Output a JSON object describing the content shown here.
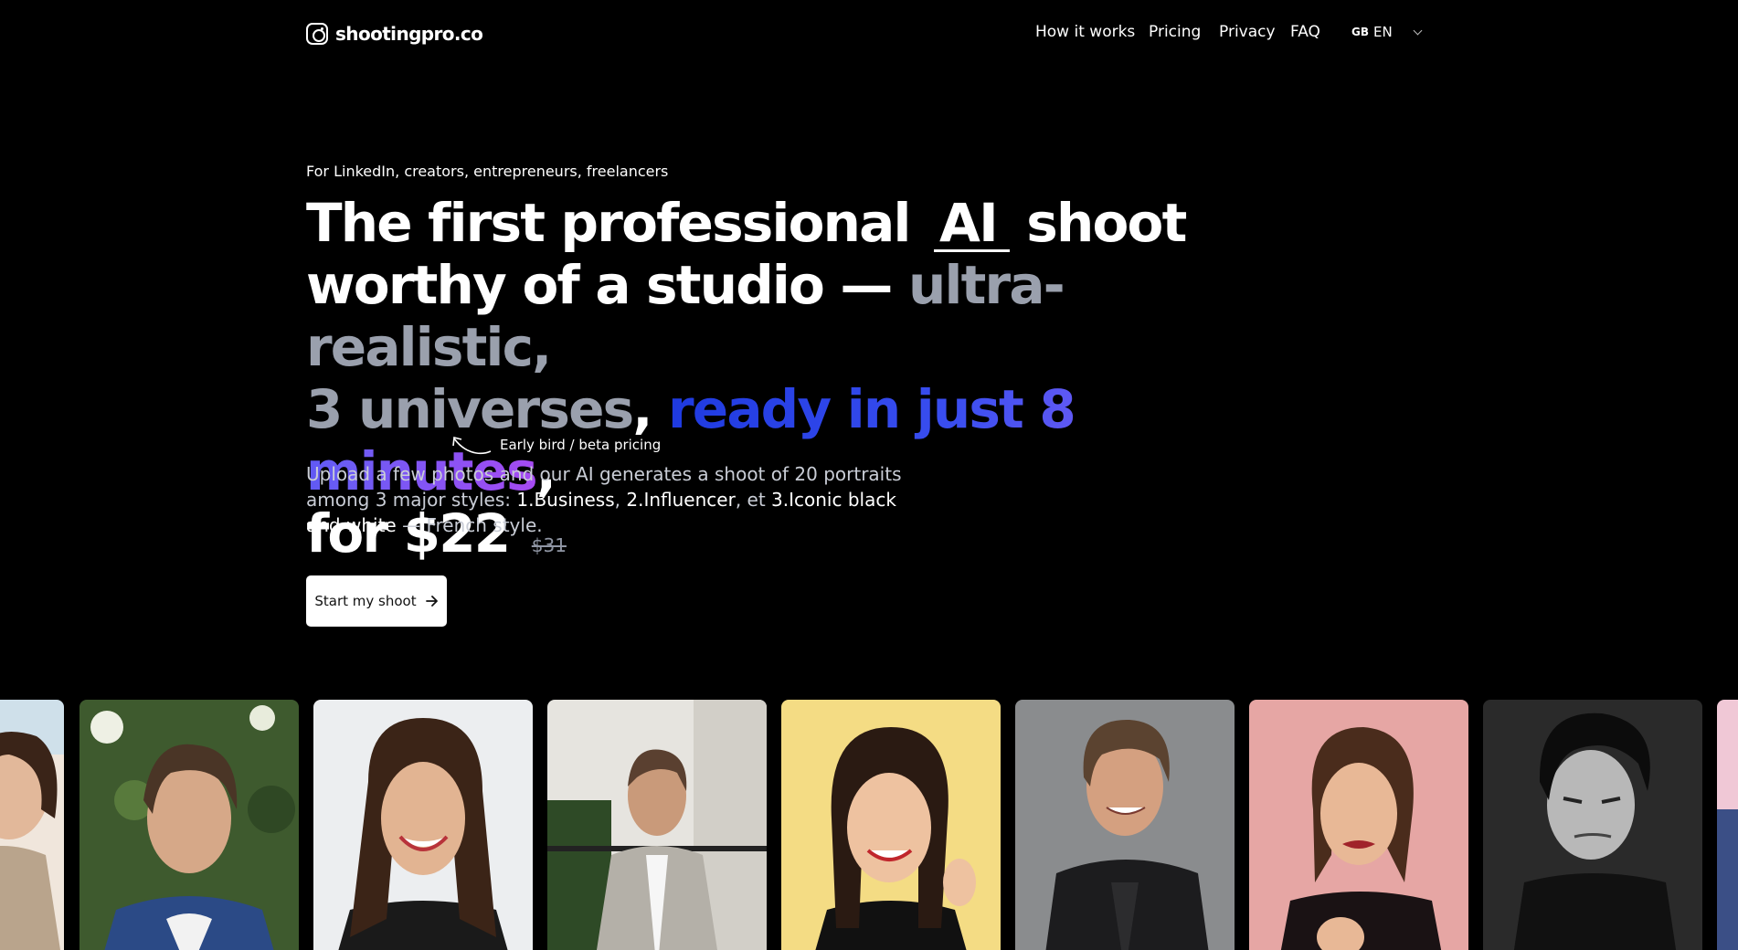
{
  "brand": {
    "name": "shootingpro.co"
  },
  "nav": {
    "items": [
      "How it works",
      "Pricing",
      "Privacy",
      "FAQ"
    ],
    "lang_flag": "GB",
    "lang_code": "EN"
  },
  "hero": {
    "tagline": "For LinkedIn, creators, entrepreneurs, freelancers",
    "headline": {
      "part1": "The first professional",
      "ai": "AI",
      "part2": "shoot",
      "part3": "worthy of a studio —",
      "muted1": "ultra-realistic,",
      "muted2": "3 universes",
      "comma1": ",",
      "gradient": "ready in just 8 minutes",
      "comma2": ",",
      "part4": "for $22",
      "old_price": "$31"
    },
    "early_bird_note": "Early bird / beta pricing",
    "description": {
      "text1": "Upload a few photos and our AI generates a shoot of 20 portraits among 3 major styles: ",
      "style1": "1.Business",
      "sep1": ", ",
      "style2": "2.Influencer",
      "sep2": ", et ",
      "style3": "3.Iconic black and white",
      "text2": " — French style."
    },
    "cta_label": "Start my shoot"
  },
  "gallery": {
    "portraits": [
      "partial-woman-blazer",
      "man-blue-suit-garden",
      "woman-smiling-white-bg",
      "man-grey-suit-street",
      "woman-yellow-bg",
      "man-black-blazer-grey-bg",
      "woman-pink-bg",
      "man-black-and-white",
      "partial-pink"
    ]
  }
}
